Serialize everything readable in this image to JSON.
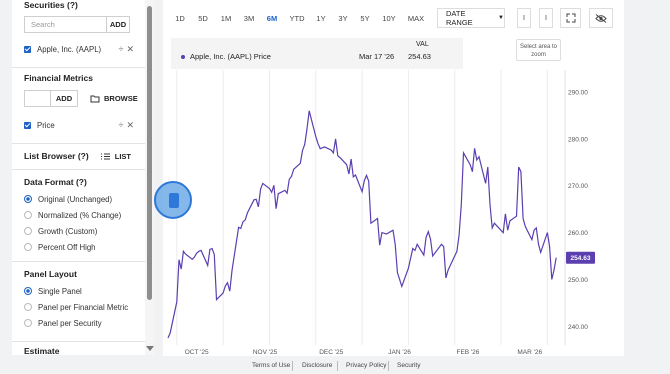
{
  "sidebar": {
    "securities": {
      "title": "Securities (?)",
      "search_placeholder": "Search",
      "add_label": "ADD",
      "items": [
        {
          "label": "Apple, Inc. (AAPL)",
          "checked": true
        }
      ]
    },
    "financial_metrics": {
      "title": "Financial Metrics",
      "add_label": "ADD",
      "browse_label": "BROWSE",
      "items": [
        {
          "label": "Price",
          "checked": true
        }
      ]
    },
    "list_browser": {
      "title": "List Browser (?)",
      "button_label": "LIST"
    },
    "data_format": {
      "title": "Data Format (?)",
      "options": [
        {
          "label": "Original (Unchanged)",
          "selected": true
        },
        {
          "label": "Normalized (% Change)",
          "selected": false
        },
        {
          "label": "Growth (Custom)",
          "selected": false
        },
        {
          "label": "Percent Off High",
          "selected": false
        }
      ]
    },
    "panel_layout": {
      "title": "Panel Layout",
      "options": [
        {
          "label": "Single Panel",
          "selected": true
        },
        {
          "label": "Panel per Financial Metric",
          "selected": false
        },
        {
          "label": "Panel per Security",
          "selected": false
        }
      ]
    },
    "next_section_partial": "Estimate"
  },
  "toolbar": {
    "ranges": [
      "1D",
      "5D",
      "1M",
      "3M",
      "6M",
      "YTD",
      "1Y",
      "3Y",
      "5Y",
      "10Y",
      "MAX"
    ],
    "active_range": "6M",
    "date_range_label": "DATE RANGE",
    "small_buttons": [
      "I",
      "I"
    ]
  },
  "legend": {
    "series_name": "Apple, Inc. (AAPL) Price",
    "date": "Mar 17 '26",
    "value_header": "VAL",
    "value": "254.63",
    "select_area": "Select area to zoom"
  },
  "chart_data": {
    "type": "line",
    "series": [
      {
        "name": "Apple, Inc. (AAPL) Price",
        "color": "#5b3fb0"
      }
    ],
    "y_ticks": [
      "290.00",
      "280.00",
      "270.00",
      "260.00",
      "250.00",
      "240.00"
    ],
    "ylim": [
      236,
      293
    ],
    "x_ticks": [
      "OCT '25",
      "NOV '25",
      "DEC '25",
      "JAN '26",
      "FEB '26",
      "MAR '26"
    ],
    "last_value_label": "254.63",
    "x": [
      "2025-09-18",
      "2025-09-19",
      "2025-09-22",
      "2025-09-23",
      "2025-09-24",
      "2025-09-25",
      "2025-09-26",
      "2025-09-29",
      "2025-09-30",
      "2025-10-01",
      "2025-10-02",
      "2025-10-03",
      "2025-10-06",
      "2025-10-07",
      "2025-10-08",
      "2025-10-09",
      "2025-10-10",
      "2025-10-13",
      "2025-10-14",
      "2025-10-15",
      "2025-10-16",
      "2025-10-17",
      "2025-10-20",
      "2025-10-21",
      "2025-10-22",
      "2025-10-23",
      "2025-10-24",
      "2025-10-27",
      "2025-10-28",
      "2025-10-29",
      "2025-10-30",
      "2025-10-31",
      "2025-11-03",
      "2025-11-04",
      "2025-11-05",
      "2025-11-06",
      "2025-11-07",
      "2025-11-10",
      "2025-11-11",
      "2025-11-12",
      "2025-11-13",
      "2025-11-14",
      "2025-11-17",
      "2025-11-18",
      "2025-11-19",
      "2025-11-20",
      "2025-11-21",
      "2025-11-24",
      "2025-11-25",
      "2025-11-26",
      "2025-11-28",
      "2025-12-01",
      "2025-12-02",
      "2025-12-03",
      "2025-12-04",
      "2025-12-05",
      "2025-12-08",
      "2025-12-09",
      "2025-12-10",
      "2025-12-11",
      "2025-12-12",
      "2025-12-15",
      "2025-12-16",
      "2025-12-17",
      "2025-12-18",
      "2025-12-19",
      "2025-12-22",
      "2025-12-23",
      "2025-12-24",
      "2025-12-26",
      "2025-12-29",
      "2025-12-30",
      "2025-12-31",
      "2026-01-02",
      "2026-01-05",
      "2026-01-06",
      "2026-01-07",
      "2026-01-08",
      "2026-01-09",
      "2026-01-12",
      "2026-01-13",
      "2026-01-14",
      "2026-01-15",
      "2026-01-16",
      "2026-01-20",
      "2026-01-21",
      "2026-01-22",
      "2026-01-23",
      "2026-01-26",
      "2026-01-27",
      "2026-01-28",
      "2026-01-29",
      "2026-01-30",
      "2026-02-02",
      "2026-02-03",
      "2026-02-04",
      "2026-02-05",
      "2026-02-06",
      "2026-02-09",
      "2026-02-10",
      "2026-02-11",
      "2026-02-12",
      "2026-02-13",
      "2026-02-17",
      "2026-02-18",
      "2026-02-19",
      "2026-02-20",
      "2026-02-23",
      "2026-02-24",
      "2026-02-25",
      "2026-02-26",
      "2026-02-27",
      "2026-03-02",
      "2026-03-03",
      "2026-03-04",
      "2026-03-05",
      "2026-03-06",
      "2026-03-09",
      "2026-03-10",
      "2026-03-11",
      "2026-03-12",
      "2026-03-13",
      "2026-03-16",
      "2026-03-17"
    ],
    "values": [
      237.5,
      238.6,
      245.2,
      254.2,
      252.2,
      256.0,
      255.4,
      254.3,
      254.8,
      255.6,
      256.0,
      256.2,
      253.0,
      256.4,
      256.6,
      255.3,
      245.7,
      247.1,
      248.6,
      249.3,
      247.5,
      251.9,
      261.1,
      260.9,
      262.3,
      262.7,
      264.2,
      267.0,
      267.1,
      265.5,
      269.3,
      270.5,
      269.4,
      268.6,
      270.1,
      265.1,
      268.3,
      269.0,
      268.4,
      271.4,
      272.0,
      273.5,
      274.8,
      277.5,
      278.8,
      282.0,
      286.0,
      280.5,
      279.0,
      277.9,
      278.3,
      277.6,
      277.0,
      280.0,
      276.4,
      276.0,
      274.5,
      272.5,
      275.7,
      271.9,
      272.3,
      268.7,
      271.1,
      272.2,
      271.0,
      262.0,
      263.0,
      257.3,
      260.0,
      259.7,
      260.5,
      257.5,
      251.5,
      248.5,
      252.4,
      254.5,
      256.6,
      256.2,
      257.5,
      255.2,
      259.0,
      260.2,
      258.6,
      255.0,
      257.5,
      257.0,
      250.3,
      252.0,
      255.0,
      256.0,
      259.5,
      266.0,
      277.0,
      274.5,
      273.0,
      278.0,
      275.5,
      276.2,
      270.5,
      274.0,
      266.0,
      261.0,
      262.0,
      260.0,
      264.0,
      260.5,
      262.5,
      263.5,
      274.0,
      273.0,
      263.0,
      261.3,
      258.5,
      260.5,
      261.0,
      257.5,
      255.8,
      260.0,
      257.0,
      250.0,
      252.0,
      254.63
    ]
  },
  "footer": [
    "Terms of Use",
    "Disclosure",
    "Privacy Policy",
    "Security"
  ]
}
